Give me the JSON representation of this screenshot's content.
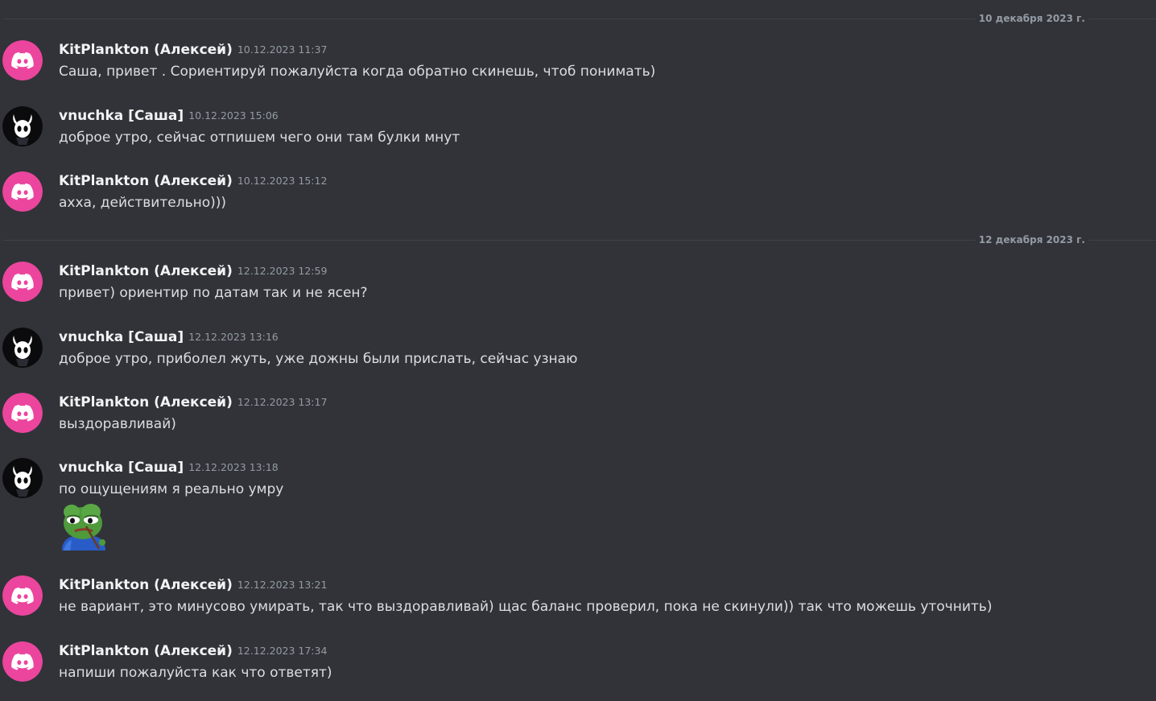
{
  "colors": {
    "background": "#313338",
    "discord_avatar_bg": "#eb459e",
    "username": "#f2f3f5",
    "timestamp": "#949ba4",
    "text": "#dbdee1",
    "divider": "#3f4147"
  },
  "dividers": [
    {
      "label": "10 декабря 2023 г."
    },
    {
      "label": "12 декабря 2023 г."
    }
  ],
  "messages": [
    {
      "author": "KitPlankton (Алексей)",
      "avatar": "discord-logo-icon",
      "time": "10.12.2023 11:37",
      "text": "Саша, привет . Сориентируй пожалуйста когда обратно скинешь, чтоб понимать)"
    },
    {
      "author": "vnuchka [Саша]",
      "avatar": "hollow-knight-icon",
      "time": "10.12.2023 15:06",
      "text": "доброе утро, сейчас отпишем чего они там булки мнут"
    },
    {
      "author": "KitPlankton (Алексей)",
      "avatar": "discord-logo-icon",
      "time": "10.12.2023 15:12",
      "text": "ахха, действительно)))"
    },
    {
      "author": "KitPlankton (Алексей)",
      "avatar": "discord-logo-icon",
      "time": "12.12.2023 12:59",
      "text": "привет) ориентир по датам так и не ясен?"
    },
    {
      "author": "vnuchka [Саша]",
      "avatar": "hollow-knight-icon",
      "time": "12.12.2023 13:16",
      "text": "доброе утро, приболел жуть, уже дожны были прислать, сейчас узнаю"
    },
    {
      "author": "KitPlankton (Алексей)",
      "avatar": "discord-logo-icon",
      "time": "12.12.2023 13:17",
      "text": "выздоравливай)"
    },
    {
      "author": "vnuchka [Саша]",
      "avatar": "hollow-knight-icon",
      "time": "12.12.2023 13:18",
      "text": "по ощущениям я реально умру",
      "sticker": "sad-pepe-sticker-icon"
    },
    {
      "author": "KitPlankton (Алексей)",
      "avatar": "discord-logo-icon",
      "time": "12.12.2023 13:21",
      "text": "не вариант, это минусово умирать, так что выздоравливай) щас баланс проверил, пока не скинули)) так что можешь уточнить)"
    },
    {
      "author": "KitPlankton (Алексей)",
      "avatar": "discord-logo-icon",
      "time": "12.12.2023 17:34",
      "text": "напиши пожалуйста как что ответят)"
    }
  ]
}
